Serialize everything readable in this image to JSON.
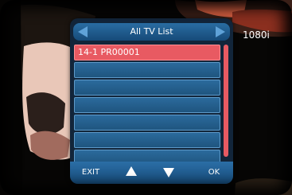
{
  "header": {
    "title": "All TV List",
    "left_icon": "arrow-left-icon",
    "right_icon": "arrow-right-icon"
  },
  "status": {
    "resolution": "1080i"
  },
  "channels": {
    "items": [
      {
        "label": "14-1 PR00001"
      },
      {
        "label": ""
      },
      {
        "label": ""
      },
      {
        "label": ""
      },
      {
        "label": ""
      },
      {
        "label": ""
      },
      {
        "label": ""
      }
    ],
    "selected_index": 0
  },
  "footer": {
    "exit_label": "EXIT",
    "ok_label": "OK",
    "up_icon": "triangle-up-icon",
    "down_icon": "triangle-down-icon"
  },
  "colors": {
    "panel": "#12253a",
    "header": "#2a6da3",
    "row": "#2b6a9c",
    "selected": "#e85a62",
    "scrollbar": "#e85a62"
  }
}
